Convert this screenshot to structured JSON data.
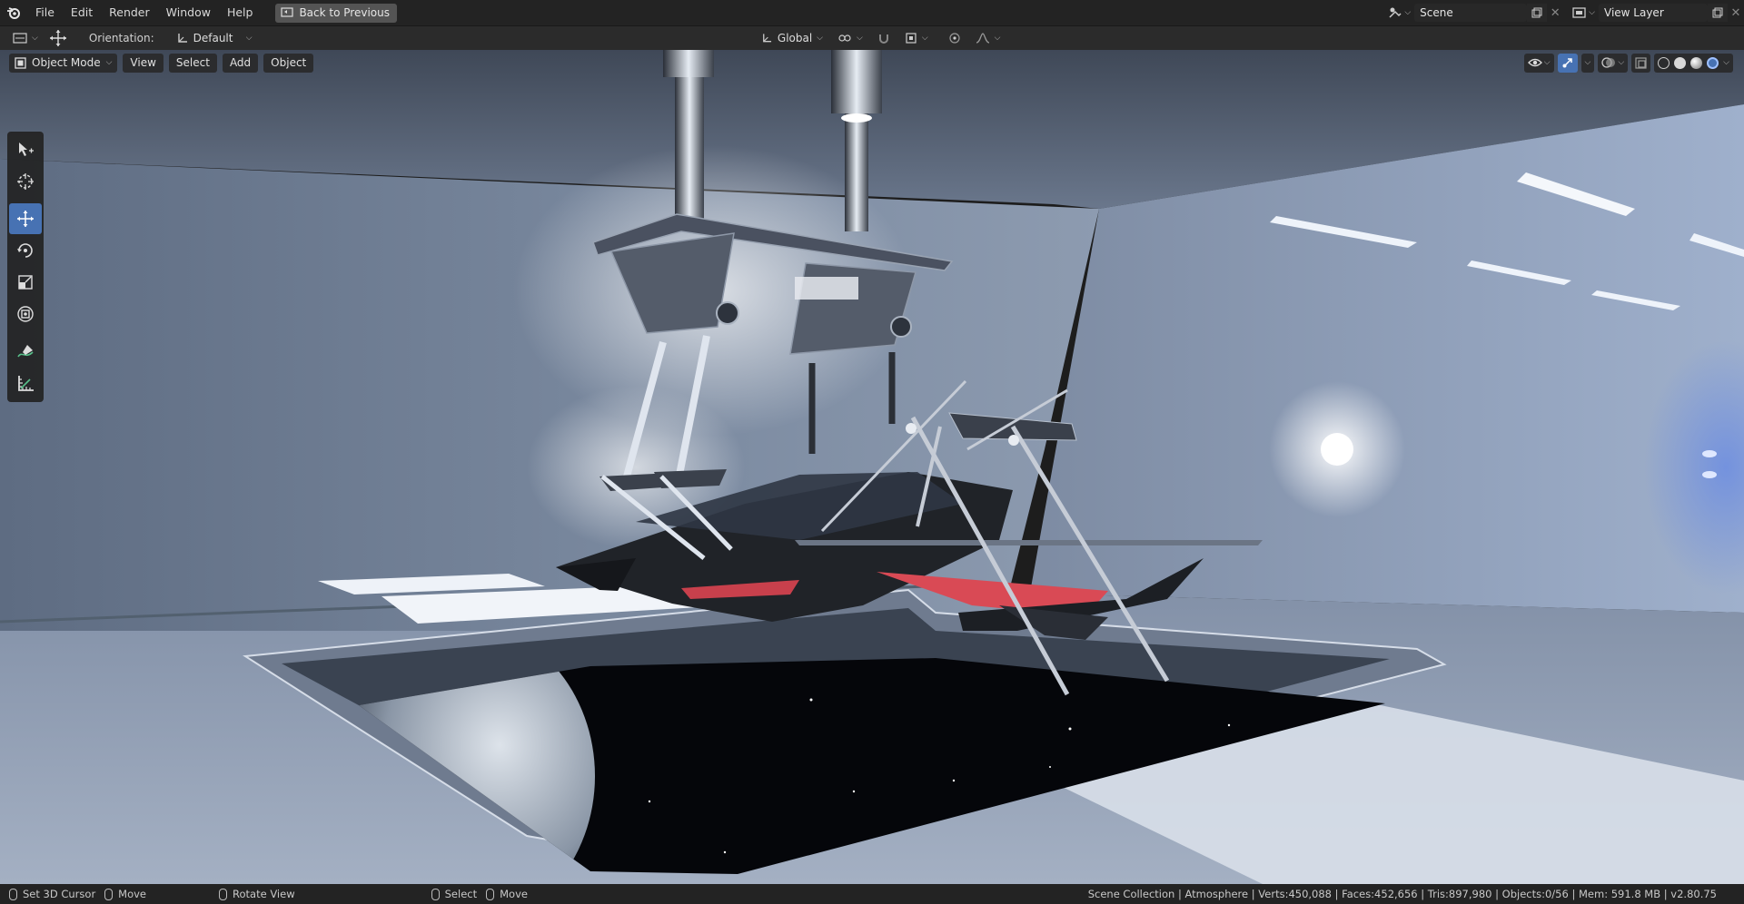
{
  "menubar": {
    "items": [
      "File",
      "Edit",
      "Render",
      "Window",
      "Help"
    ],
    "back_button": "Back to Previous",
    "scene": "Scene",
    "view_layer": "View Layer"
  },
  "toolheader": {
    "orientation_label": "Orientation:",
    "orientation_value": "Default",
    "transform_space": "Global"
  },
  "viewport": {
    "mode": "Object Mode",
    "menus": [
      "View",
      "Select",
      "Add",
      "Object"
    ]
  },
  "statusbar": {
    "items": [
      {
        "icon": "mouse-left-icon",
        "label": "Set 3D Cursor"
      },
      {
        "icon": "mouse-middle-icon",
        "label": "Move"
      },
      {
        "icon": "mouse-middle-icon",
        "label": "Rotate View"
      },
      {
        "icon": "mouse-left-icon",
        "label": "Select"
      },
      {
        "icon": "mouse-middle-icon",
        "label": "Move"
      }
    ],
    "stats": "Scene Collection | Atmosphere | Verts:450,088 | Faces:452,656 | Tris:897,980 | Objects:0/56 | Mem: 591.8 MB | v2.80.75"
  },
  "colors": {
    "accent": "#4772b3",
    "topbar": "#232323",
    "header": "#2b2b2b"
  }
}
